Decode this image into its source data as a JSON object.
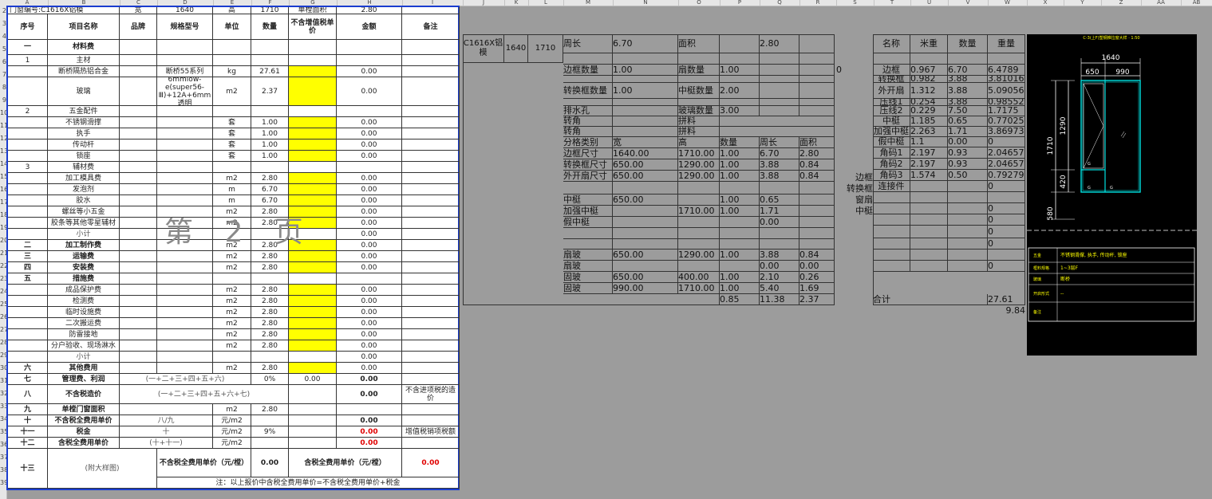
{
  "col_headers": [
    "A",
    "B",
    "C",
    "D",
    "E",
    "F",
    "G",
    "H",
    "I",
    "J",
    "K",
    "L",
    "M",
    "N",
    "O",
    "P",
    "Q",
    "R",
    "S",
    "T",
    "U",
    "V",
    "W",
    "X",
    "Y",
    "Z",
    "AA",
    "AB"
  ],
  "row_numbers": [
    "2",
    "3",
    "4",
    "5",
    "6",
    "7",
    "8",
    "9",
    "10",
    "11",
    "12",
    "13",
    "14",
    "15",
    "16",
    "17",
    "18",
    "19",
    "20",
    "21",
    "22",
    "23",
    "24",
    "25",
    "26",
    "27",
    "28",
    "29",
    "30",
    "31",
    "32",
    "33",
    "34",
    "35",
    "36",
    "37",
    "38",
    "39"
  ],
  "top_info": {
    "window_code": "门窗编号:C1616X铝模",
    "width_label": "宽",
    "width_value": "1640",
    "height_label": "高",
    "height_value": "1710",
    "area_label": "单樘面积",
    "area_value": "2.80"
  },
  "headers": {
    "seq": "序号",
    "item": "项目名称",
    "brand": "品牌",
    "spec": "规格型号",
    "unit": "单位",
    "qty": "数量",
    "price": "不含增值税单价",
    "amount": "金额",
    "note": "备注"
  },
  "rows": [
    {
      "seq": "一",
      "item": "材料费",
      "bold": true
    },
    {
      "seq": "1",
      "item": "主材"
    },
    {
      "item": "断桥隔热铝合金",
      "spec": "断桥55系列",
      "unit": "kg",
      "qty": "27.61",
      "amount": "0.00",
      "yellow": true
    },
    {
      "item": "玻璃",
      "spec": "6mmlow-e(super56-Ⅲ)+12A+6mm透明",
      "unit": "m2",
      "qty": "2.37",
      "amount": "0.00",
      "yellow": true,
      "tall": true
    },
    {
      "seq": "2",
      "item": "五金配件"
    },
    {
      "item": "不锈钢滑撑",
      "unit": "套",
      "qty": "1.00",
      "amount": "0.00",
      "yellow": true
    },
    {
      "item": "执手",
      "unit": "套",
      "qty": "1.00",
      "amount": "0.00",
      "yellow": true
    },
    {
      "item": "传动杆",
      "unit": "套",
      "qty": "1.00",
      "amount": "0.00",
      "yellow": true
    },
    {
      "item": "锁座",
      "unit": "套",
      "qty": "1.00",
      "amount": "0.00",
      "yellow": true
    },
    {
      "seq": "3",
      "item": "辅材费"
    },
    {
      "item": "加工模具费",
      "unit": "m2",
      "qty": "2.80",
      "amount": "0.00",
      "yellow": true
    },
    {
      "item": "发泡剂",
      "unit": "m",
      "qty": "6.70",
      "amount": "0.00",
      "yellow": true
    },
    {
      "item": "胶水",
      "unit": "m",
      "qty": "6.70",
      "amount": "0.00",
      "yellow": true
    },
    {
      "item": "螺丝等小五金",
      "unit": "m2",
      "qty": "2.80",
      "amount": "0.00",
      "yellow": true
    },
    {
      "item": "胶条等其他零星辅材",
      "unit": "m2",
      "qty": "2.80",
      "amount": "0.00",
      "yellow": true
    },
    {
      "item": "小计",
      "amount": "0.00",
      "gray": true
    },
    {
      "seq": "二",
      "item": "加工制作费",
      "unit": "m2",
      "qty": "2.80",
      "amount": "0.00",
      "yellow": true,
      "bold": true
    },
    {
      "seq": "三",
      "item": "运输费",
      "unit": "m2",
      "qty": "2.80",
      "amount": "0.00",
      "yellow": true,
      "bold": true
    },
    {
      "seq": "四",
      "item": "安装费",
      "unit": "m2",
      "qty": "2.80",
      "amount": "0.00",
      "yellow": true,
      "bold": true
    },
    {
      "seq": "五",
      "item": "措施费",
      "bold": true
    },
    {
      "item": "成品保护费",
      "unit": "m2",
      "qty": "2.80",
      "amount": "0.00",
      "yellow": true
    },
    {
      "item": "检测费",
      "unit": "m2",
      "qty": "2.80",
      "amount": "0.00",
      "yellow": true
    },
    {
      "item": "临时设施费",
      "unit": "m2",
      "qty": "2.80",
      "amount": "0.00",
      "yellow": true
    },
    {
      "item": "二次搬运费",
      "unit": "m2",
      "qty": "2.80",
      "amount": "0.00",
      "yellow": true
    },
    {
      "item": "防雷接地",
      "unit": "m2",
      "qty": "2.80",
      "amount": "0.00",
      "yellow": true
    },
    {
      "item": "分户验收、现场淋水",
      "unit": "m2",
      "qty": "2.80",
      "amount": "0.00",
      "yellow": true
    },
    {
      "item": "小计",
      "amount": "0.00",
      "gray": true
    },
    {
      "seq": "六",
      "item": "其他费用",
      "unit": "m2",
      "qty": "2.80",
      "amount": "0.00",
      "yellow": true,
      "bold": true
    }
  ],
  "summary": {
    "r7_seq": "七",
    "r7_item": "管理费、利润",
    "r7_formula": "(一+二+三+四+五+六)",
    "r7_qty": "0%",
    "r7_price": "0.00",
    "r7_amount": "0.00",
    "r8_seq": "八",
    "r8_item": "不含税造价",
    "r8_formula": "(一+二+三+四+五+六+七)",
    "r8_amount": "0.00",
    "r8_note": "不含进项税的造价",
    "r9_seq": "九",
    "r9_item": "单樘门窗面积",
    "r9_unit": "m2",
    "r9_qty": "2.80",
    "r10_seq": "十",
    "r10_item": "不含税全费用单价",
    "r10_formula": "八/九",
    "r10_unit": "元/m2",
    "r10_amount": "0.00",
    "r11_seq": "十一",
    "r11_item": "税金",
    "r11_formula": "十",
    "r11_unit": "元/m2",
    "r11_qty": "9%",
    "r11_amount": "0.00",
    "r11_note": "增值税销项税额",
    "r12_seq": "十二",
    "r12_item": "含税全费用单价",
    "r12_formula": "(十+十一)",
    "r12_unit": "元/m2",
    "r12_amount": "0.00",
    "r13_seq": "十三",
    "r13_drawing": "(附大样图)",
    "r13_label1": "不含税全费用单价（元/樘）",
    "r13_val1": "0.00",
    "r13_label2": "含税全费用单价（元/樘）",
    "r13_val2": "0.00",
    "footnote": "注：以上报价中含税全费用单价=不含税全费用单价+税金"
  },
  "watermark": "第 2 页",
  "calc": {
    "code": "C1616X铝模",
    "w": "1640",
    "h": "1710",
    "perimeter_label": "周长",
    "perimeter": "6.70",
    "area_label": "面积",
    "area": "2.80",
    "frame_count_label": "边框数量",
    "frame_count": "1.00",
    "sash_count_label": "扇数量",
    "sash_count": "1.00",
    "zero_flag": "0",
    "conv_count_label": "转换框数量",
    "conv_count": "1.00",
    "mullion_count_label": "中梃数量",
    "mullion_count": "2.00",
    "drain_label": "排水孔",
    "glass_count_label": "玻璃数量",
    "glass_count": "3.00",
    "corner1": "转角",
    "splice1": "拼料",
    "corner2": "转角",
    "splice2": "拼料",
    "grid": {
      "head": [
        "分格类别",
        "宽",
        "高",
        "数量",
        "周长",
        "面积"
      ],
      "rows": [
        [
          "边框尺寸",
          "1640.00",
          "1710.00",
          "1.00",
          "6.70",
          "2.80"
        ],
        [
          "转换框尺寸",
          "650.00",
          "1290.00",
          "1.00",
          "3.88",
          "0.84"
        ],
        [
          "外开扇尺寸",
          "650.00",
          "1290.00",
          "1.00",
          "3.88",
          "0.84"
        ]
      ]
    },
    "mullion": [
      "中梃",
      "650.00",
      "",
      "1.00",
      "0.65"
    ],
    "strong_mullion": [
      "加强中梃",
      "",
      "1710.00",
      "1.00",
      "1.71"
    ],
    "fake_mullion": [
      "假中梃",
      "",
      "",
      "",
      "0.00"
    ],
    "glass_rows": [
      [
        "扇玻",
        "650.00",
        "1290.00",
        "1.00",
        "3.88",
        "0.84"
      ],
      [
        "扇玻",
        "",
        "",
        "",
        "0.00",
        "0.00"
      ],
      [
        "固玻",
        "650.00",
        "400.00",
        "1.00",
        "2.10",
        "0.26"
      ],
      [
        "固玻",
        "990.00",
        "1710.00",
        "1.00",
        "5.40",
        "1.69"
      ]
    ],
    "totals": [
      "0.85",
      "11.38",
      "2.37"
    ]
  },
  "side_labels": [
    "边框",
    "转换框",
    "窗扇",
    "中梃"
  ],
  "weights": {
    "head": [
      "名称",
      "米重",
      "数量",
      "重量"
    ],
    "rows": [
      [
        "边框",
        "0.967",
        "6.70",
        "6.4789"
      ],
      [
        "转换框",
        "0.982",
        "3.88",
        "3.81016"
      ],
      [
        "外开扇",
        "1.312",
        "3.88",
        "5.09056"
      ],
      [
        "压线1",
        "0.254",
        "3.88",
        "0.98552"
      ],
      [
        "压线2",
        "0.229",
        "7.50",
        "1.7175"
      ],
      [
        "中梃",
        "1.185",
        "0.65",
        "0.77025"
      ],
      [
        "加强中梃",
        "2.263",
        "1.71",
        "3.86973"
      ],
      [
        "假中梃",
        "1.1",
        "0.00",
        "0"
      ],
      [
        "角码1",
        "2.197",
        "0.93",
        "2.04657"
      ],
      [
        "角码2",
        "2.197",
        "0.93",
        "2.04657"
      ],
      [
        "角码3",
        "1.574",
        "0.50",
        "0.79279"
      ],
      [
        "连接件",
        "",
        "",
        "0"
      ],
      [
        "",
        "",
        "",
        ""
      ],
      [
        "",
        "",
        "",
        "0"
      ],
      [
        "",
        "",
        "",
        "0"
      ],
      [
        "",
        "",
        "",
        "0"
      ],
      [
        "",
        "",
        "",
        "0"
      ],
      [
        "",
        "",
        "",
        ""
      ],
      [
        "",
        "",
        "",
        "0"
      ]
    ],
    "total_label": "合计",
    "total": "27.61",
    "extra": "9.84"
  },
  "dwg": {
    "title": "C-3(上F)塑钢推拉窗大样 · 1:50",
    "dim_total": "1640",
    "dim_left": "650",
    "dim_right": "990",
    "dim_h": "1710",
    "dim_h1": "1290",
    "dim_h2": "420",
    "dim_h3": "580",
    "g": "G",
    "legend": [
      [
        "五金",
        "不锈钢滑撑, 执手, 传动杆, 锁座"
      ],
      [
        "框料规格",
        "1~3层F"
      ],
      [
        "玻璃",
        "断桥"
      ],
      [
        "开启形式",
        "--"
      ],
      [
        "备注",
        ""
      ]
    ]
  }
}
